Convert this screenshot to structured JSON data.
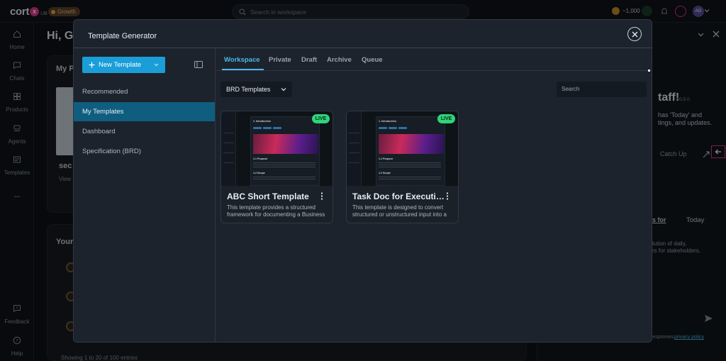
{
  "topbar": {
    "logo_text": "cort",
    "logo_mark": "x",
    "logo_suffix": "UB",
    "plan_badge": "Growth",
    "search_placeholder": "Search in workspace",
    "credits": "~1,000",
    "avatar_initials": "AG"
  },
  "nav": {
    "items": [
      {
        "label": "Home",
        "icon": "home-icon"
      },
      {
        "label": "Chats",
        "icon": "chat-icon"
      },
      {
        "label": "Products",
        "icon": "products-icon"
      },
      {
        "label": "Agents",
        "icon": "agents-icon"
      },
      {
        "label": "Templates",
        "icon": "templates-icon"
      }
    ],
    "more": "...",
    "feedback": "Feedback",
    "help": "Help"
  },
  "background": {
    "greeting": "Hi, G",
    "card1_title": "My P",
    "card1_item": "sec",
    "card1_sub": "View",
    "card2_title": "Your",
    "pagination": "Showing 1 to 20 of 100 entries",
    "right_title": "taff!",
    "right_version": "v0.5.0",
    "right_line1": "has 'Today' and",
    "right_line2": "tings, and updates.",
    "catch_up": "Catch Up",
    "link_text": "s for",
    "today": "Today",
    "desc1": "lution of daily,",
    "desc2": "rs for stakeholders.",
    "footer_text": "responses",
    "privacy": "privacy policy"
  },
  "modal": {
    "title": "Template Generator",
    "new_template_label": "New Template",
    "sidebar": [
      {
        "label": "Recommended",
        "active": false
      },
      {
        "label": "My Templates",
        "active": true
      },
      {
        "label": "Dashboard",
        "active": false
      },
      {
        "label": "Specification (BRD)",
        "active": false
      }
    ],
    "tabs": [
      "Workspace",
      "Private",
      "Draft",
      "Archive",
      "Queue"
    ],
    "active_tab": "Workspace",
    "filter_value": "BRD Templates",
    "search_placeholder": "Search",
    "cards": [
      {
        "title": "ABC Short Template",
        "description": "This template provides a structured framework for documenting a Business Requirements Document.",
        "status": "LIVE",
        "preview_heading": "1. Introduction",
        "preview_section1": "1.1 Purpose",
        "preview_section2": "1.2 Scope"
      },
      {
        "title": "Task Doc for Execution",
        "description": "This template is designed to convert structured or unstructured input into a task document.",
        "status": "LIVE",
        "preview_heading": "1. Introduction",
        "preview_section1": "1.1 Purpose",
        "preview_section2": "1.2 Scope"
      }
    ]
  }
}
